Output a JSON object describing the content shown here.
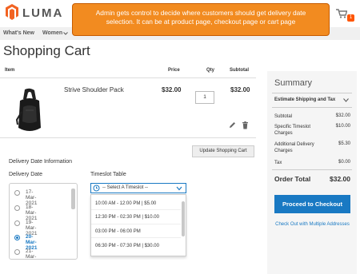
{
  "header": {
    "logo_text": "LUMA",
    "cart_count": "1"
  },
  "callout": {
    "text": "Admin gets control to decide where customers should get delivery date selection. It can be at product page, checkout page or cart page"
  },
  "nav": {
    "items": [
      {
        "label": "What's New"
      },
      {
        "label": "Women"
      }
    ]
  },
  "page": {
    "title": "Shopping Cart"
  },
  "cart_table": {
    "headers": {
      "item": "Item",
      "price": "Price",
      "qty": "Qty",
      "subtotal": "Subtotal"
    },
    "rows": [
      {
        "name": "Strive Shoulder Pack",
        "price": "$32.00",
        "qty": "1",
        "subtotal": "$32.00"
      }
    ]
  },
  "buttons": {
    "update_cart": "Update Shopping Cart",
    "checkout": "Proceed to Checkout",
    "multi_address": "Check Out with Multiple Addresses"
  },
  "delivery": {
    "section_title": "Delivery Date Information",
    "date_label": "Delivery Date",
    "timeslot_label": "Timeslot Table",
    "dates": [
      {
        "label": "17-Mar-2021",
        "selected": false
      },
      {
        "label": "18-Mar-2021",
        "selected": false
      },
      {
        "label": "19-Mar-2021",
        "selected": false
      },
      {
        "label": "20-Mar-2021",
        "selected": true
      },
      {
        "label": "21-Mar-2021",
        "selected": false
      }
    ],
    "timeslot_placeholder": "-- Select A Timeslot --",
    "timeslots": [
      {
        "label": "10:00 AM - 12:00 PM | $5.00"
      },
      {
        "label": "12:30 PM - 02:30 PM | $10.00"
      },
      {
        "label": "03:00 PM - 06:00 PM"
      },
      {
        "label": "06:30 PM - 07:30 PM | $30.00"
      }
    ]
  },
  "summary": {
    "title": "Summary",
    "estimate": "Estimate Shipping and Tax",
    "lines": [
      {
        "label": "Subtotal",
        "value": "$32.00"
      },
      {
        "label": "Specific Timeslot Charges",
        "value": "$10.00"
      },
      {
        "label": "Additional Delivery Charges",
        "value": "$5.30"
      },
      {
        "label": "Tax",
        "value": "$0.00"
      }
    ],
    "order_total_label": "Order Total",
    "order_total_value": "$32.00"
  },
  "colors": {
    "accent": "#1979c3",
    "callout": "#f28b20",
    "brand": "#ff5501"
  }
}
